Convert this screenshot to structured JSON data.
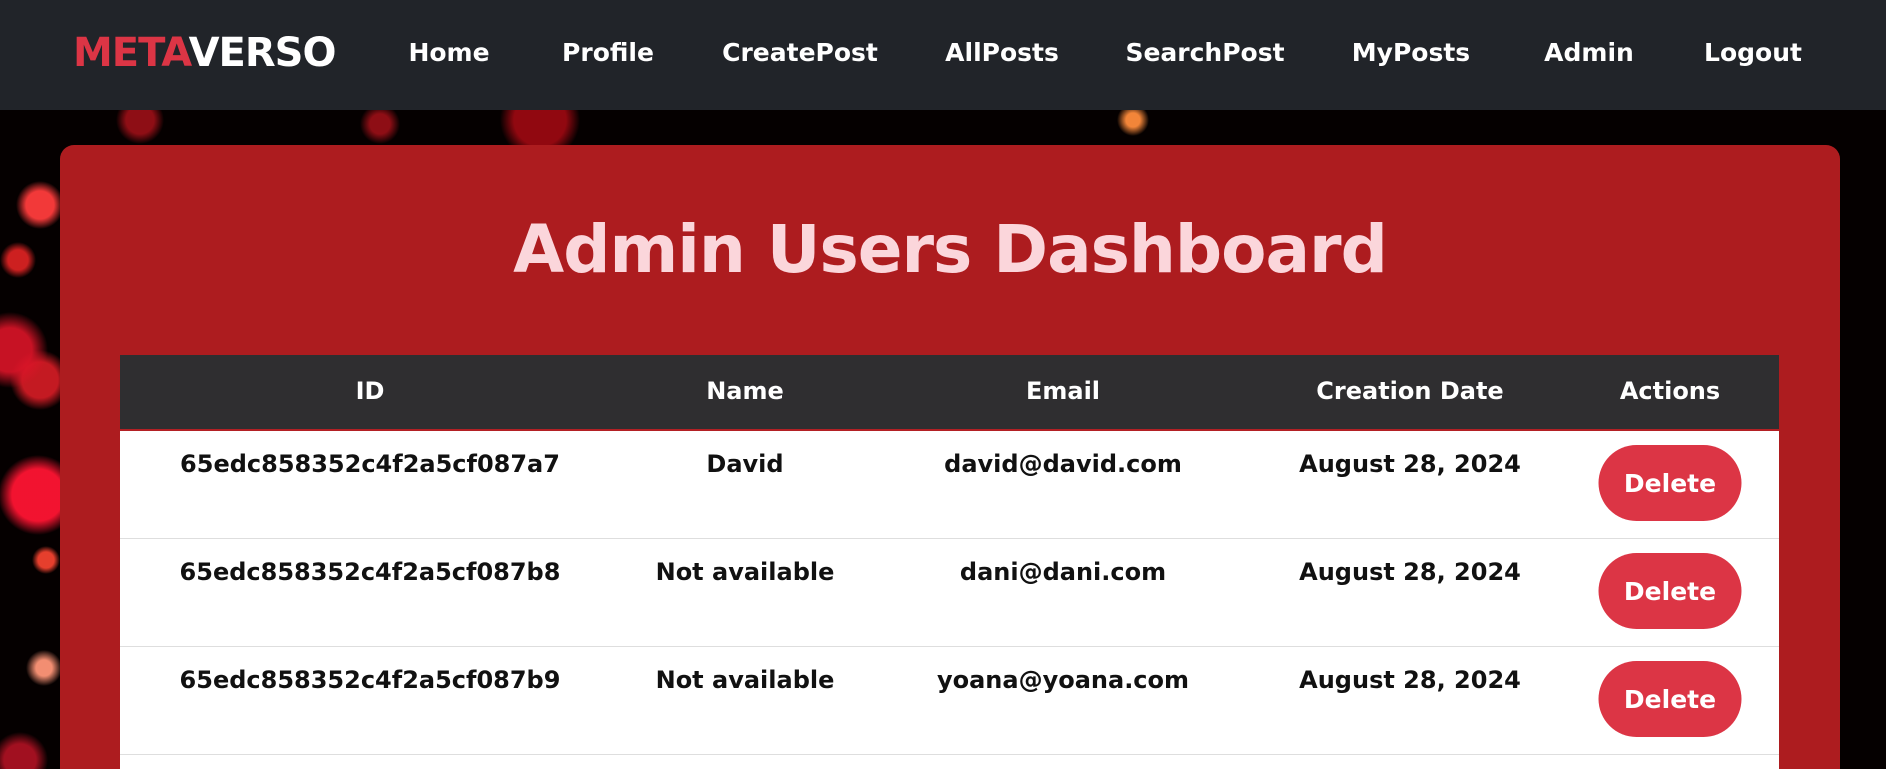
{
  "brand": {
    "part1": "META",
    "part2": "VERSO",
    "part1_color": "#dc3545",
    "part2_color": "#ffffff"
  },
  "nav": {
    "items": [
      {
        "label": "Home"
      },
      {
        "label": "Profile"
      },
      {
        "label": "CreatePost"
      },
      {
        "label": "AllPosts"
      },
      {
        "label": "SearchPost"
      },
      {
        "label": "MyPosts"
      },
      {
        "label": "Admin"
      },
      {
        "label": "Logout"
      }
    ]
  },
  "page": {
    "title": "Admin Users Dashboard"
  },
  "table": {
    "headers": {
      "id": "ID",
      "name": "Name",
      "email": "Email",
      "date": "Creation Date",
      "actions": "Actions"
    },
    "rows": [
      {
        "id": "65edc858352c4f2a5cf087a7",
        "name": "David",
        "email": "david@david.com",
        "date": "August 28, 2024",
        "action": "Delete"
      },
      {
        "id": "65edc858352c4f2a5cf087b8",
        "name": "Not available",
        "email": "dani@dani.com",
        "date": "August 28, 2024",
        "action": "Delete"
      },
      {
        "id": "65edc858352c4f2a5cf087b9",
        "name": "Not available",
        "email": "yoana@yoana.com",
        "date": "August 28, 2024",
        "action": "Delete"
      }
    ]
  },
  "colors": {
    "nav_bg": "#212429",
    "card_bg": "#ad1c1f",
    "title_color": "#fbd6db",
    "table_header_bg": "#2f2e30",
    "delete_button": "#dc3545"
  }
}
